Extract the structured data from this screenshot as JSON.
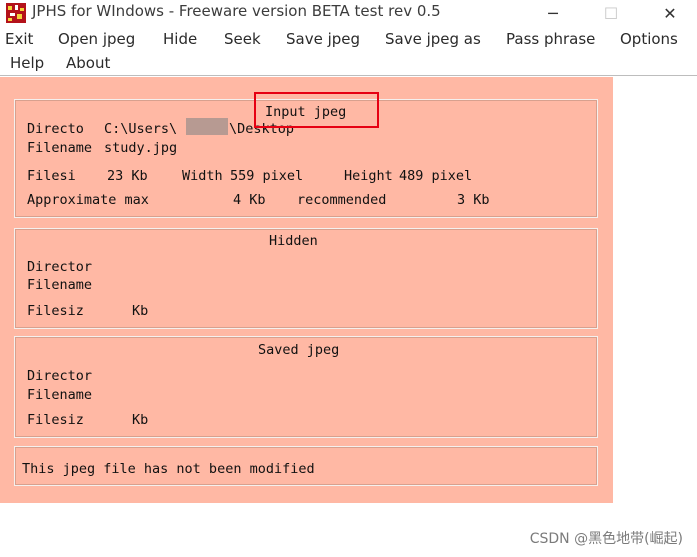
{
  "window": {
    "title": "JPHS for WIndows - Freeware version BETA test rev 0.5",
    "minimize_glyph": "─",
    "maximize_glyph": "☐",
    "close_glyph": "✕"
  },
  "menu": {
    "items": [
      "Exit",
      "Open jpeg",
      "Hide",
      "Seek",
      "Save jpeg",
      "Save jpeg as",
      "Pass phrase",
      "Options",
      "Help",
      "About"
    ]
  },
  "input_jpeg": {
    "title": "Input jpeg",
    "directory_label": "Directo",
    "directory_path_start": "C:\\Users\\",
    "directory_path_end": "\\Desktop",
    "filename_label": "Filename",
    "filename_value": "study.jpg",
    "filesize_label": "Filesi",
    "filesize_value": "23 Kb",
    "width_label": "Width",
    "width_value": "559 pixel",
    "height_label": "Height",
    "height_value": "489 pixel",
    "approx_label": "Approximate max",
    "approx_value": "4 Kb",
    "recommended_label": "recommended",
    "recommended_value": "3 Kb"
  },
  "hidden": {
    "title": "Hidden",
    "directory_label": "Director",
    "filename_label": "Filename",
    "filesize_label": "Filesiz",
    "filesize_unit": "Kb"
  },
  "saved_jpeg": {
    "title": "Saved jpeg",
    "directory_label": "Director",
    "filename_label": "Filename",
    "filesize_label": "Filesiz",
    "filesize_unit": "Kb"
  },
  "status": {
    "message": "This jpeg file has not been modified"
  },
  "watermark": {
    "text": "CSDN @黑色地带(崛起)"
  },
  "colors": {
    "panel_bg": "#ffb8a4",
    "highlight": "#e60012"
  }
}
